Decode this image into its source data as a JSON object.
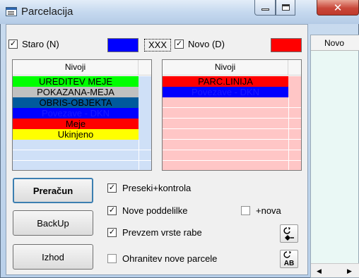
{
  "window": {
    "title": "Parcelacija"
  },
  "old": {
    "checkbox_label": "Staro (N)",
    "checked": true,
    "color": "#0000ff"
  },
  "placeholder_text": "XXX",
  "new": {
    "checkbox_label": "Novo (D)",
    "checked": true,
    "color": "#ff0000"
  },
  "left_list": {
    "header": "Nivoji",
    "rows": [
      {
        "label": "UREDITEV MEJE",
        "bg": "#00ff00",
        "fg": "#000000"
      },
      {
        "label": "POKAZANA-MEJA",
        "bg": "#c0c0c0",
        "fg": "#000000"
      },
      {
        "label": "OBRIS-OBJEKTA",
        "bg": "#005a9c",
        "fg": "#000000"
      },
      {
        "label": "Povezave - DKN",
        "bg": "#0000ff",
        "fg": "#1a1aff"
      },
      {
        "label": "Meje",
        "bg": "#ff0000",
        "fg": "#000000"
      },
      {
        "label": "Ukinjeno",
        "bg": "#ffff00",
        "fg": "#000000"
      }
    ],
    "empty_bg": "#cfe0f7"
  },
  "right_list": {
    "header": "Nivoji",
    "rows": [
      {
        "label": "PARC.LINIJA",
        "bg": "#ff0000",
        "fg": "#000000"
      },
      {
        "label": "Povezave - DKN",
        "bg": "#0000ff",
        "fg": "#1a1aff"
      }
    ],
    "empty_bg": "#ffc6c6"
  },
  "buttons": {
    "recalc": "Preračun",
    "backup": "BackUp",
    "exit": "Izhod"
  },
  "options": {
    "intersections": {
      "label": "Preseki+kontrola",
      "checked": true
    },
    "new_subparcels": {
      "label": "Nove poddelilke",
      "checked": true
    },
    "plus_new": {
      "label": "+nova",
      "checked": false
    },
    "take_usage": {
      "label": "Prevzem vrste rabe",
      "checked": true
    },
    "keep_new": {
      "label": "Ohranitev nove parcele",
      "checked": false
    }
  },
  "side_panel": {
    "header": "Novo"
  },
  "icons": {
    "tool_top": "tool-swap-icon",
    "tool_bottom": "tool-ab-icon",
    "tool_bottom_label": "AB"
  }
}
